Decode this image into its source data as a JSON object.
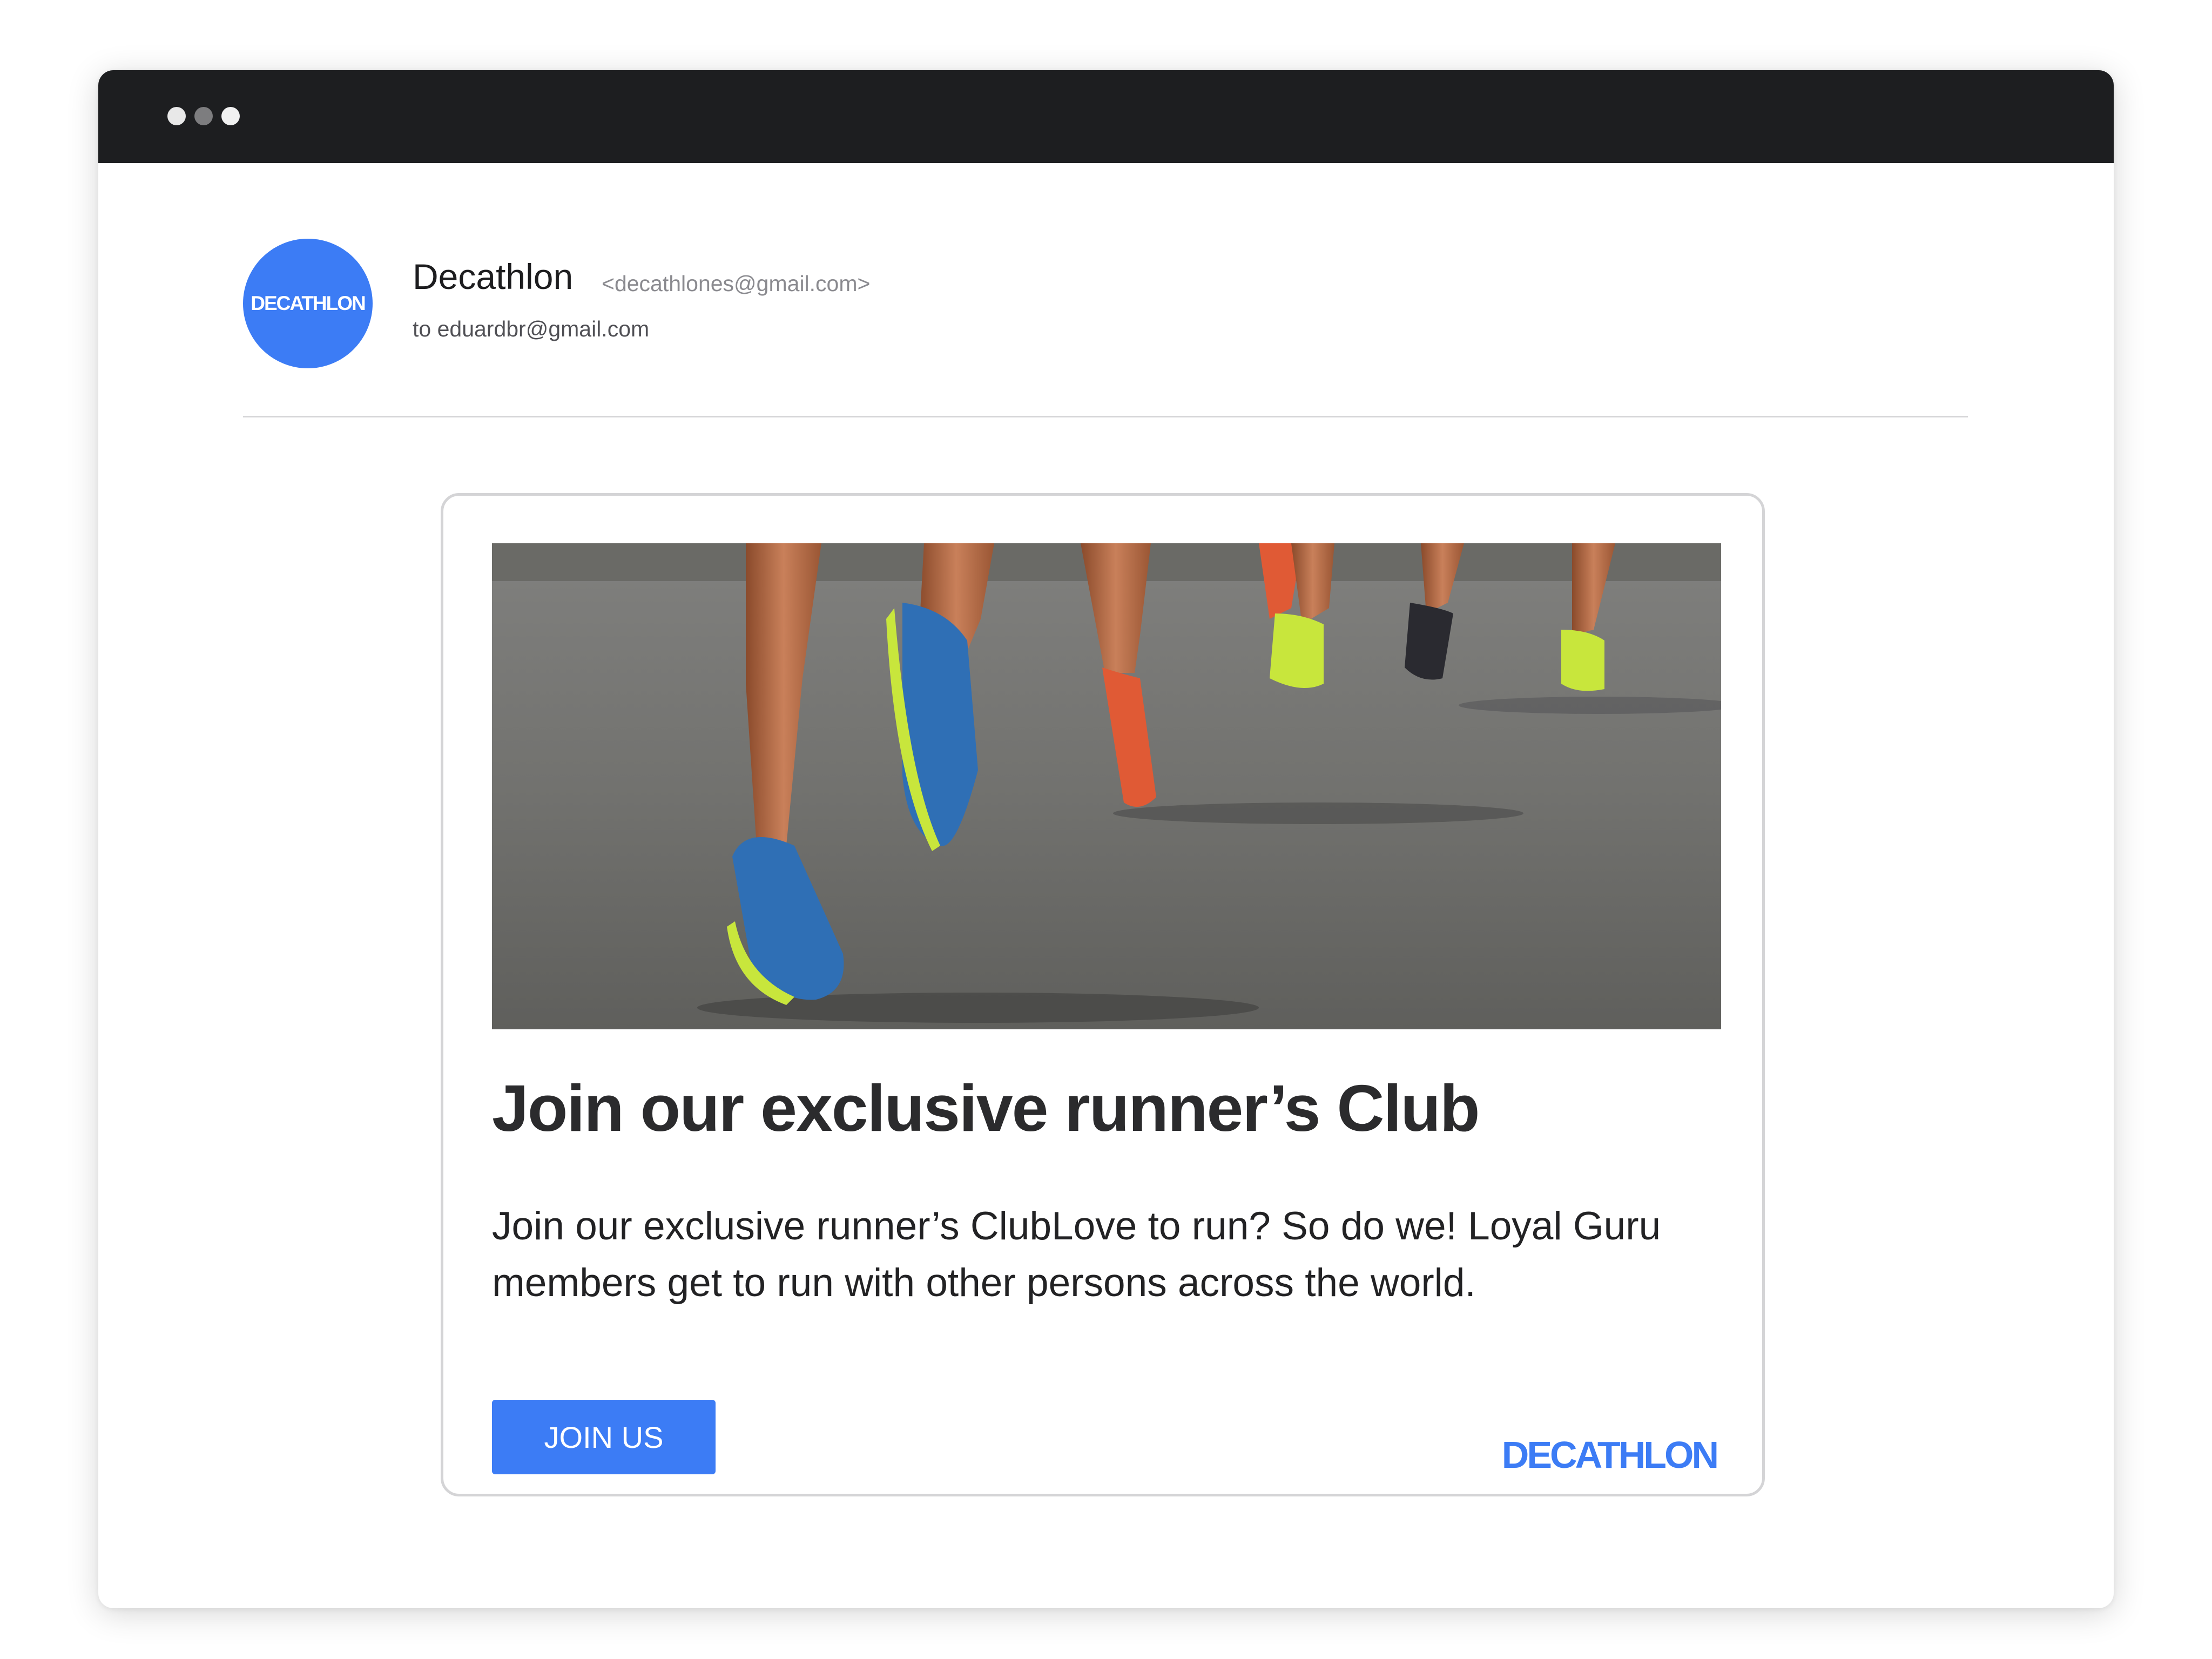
{
  "window": {
    "controls": [
      "close",
      "minimize",
      "maximize"
    ]
  },
  "sender": {
    "avatar_text": "DECATHLON",
    "name": "Decathlon",
    "email": "<decathlones@gmail.com>",
    "recipient": "to eduardbr@gmail.com"
  },
  "card": {
    "hero_image": "runners-legs-on-road",
    "title": "Join our exclusive runner’s Club",
    "body": "Join our exclusive runner’s ClubLove to run? So do we! Loyal Guru members get to run with other persons across the world.",
    "button_label": "JOIN US",
    "logo_text": "DECATHLON"
  },
  "colors": {
    "brand_blue": "#3c7cf5",
    "titlebar": "#1d1e20",
    "divider": "#d6d6d8"
  }
}
